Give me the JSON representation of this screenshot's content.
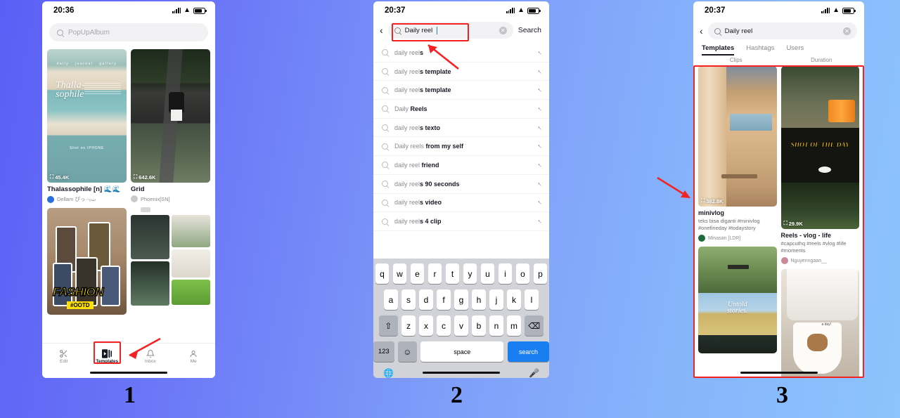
{
  "background": {
    "from": "#5b5ef5",
    "to": "#8cc4fc"
  },
  "accent_red": "#f42222",
  "steps": [
    {
      "number": "1"
    },
    {
      "number": "2"
    },
    {
      "number": "3"
    }
  ],
  "phone1": {
    "status": {
      "time": "20:36"
    },
    "search": {
      "placeholder": "PopUpAlbum",
      "icon": "search-icon"
    },
    "templates": [
      {
        "title": "Thalassophile [n] 🌊🌊",
        "uses": "45.4K",
        "author": "Dellam ぴっ·-ت₆",
        "avatar_color": "#2a6fdb",
        "art": "beach"
      },
      {
        "title": "Grid",
        "uses": "642.6K",
        "author": "Phoenix[SN]",
        "avatar_color": "#c9c9cd",
        "art": "road"
      },
      {
        "title": "",
        "uses": "",
        "author": "",
        "avatar_color": "#cccccc",
        "art": "fashion"
      },
      {
        "title": "",
        "uses": "",
        "author": "",
        "avatar_color": "#cccccc",
        "art": "minigrid"
      }
    ],
    "nav": [
      {
        "label": "Edit",
        "icon": "scissors-icon",
        "active": false
      },
      {
        "label": "Templates",
        "icon": "templates-icon",
        "active": true
      },
      {
        "label": "Inbox",
        "icon": "bell-icon",
        "active": false
      },
      {
        "label": "Me",
        "icon": "person-icon",
        "active": false
      }
    ]
  },
  "phone2": {
    "status": {
      "time": "20:37"
    },
    "back_icon": "chevron-left-icon",
    "search": {
      "value": "Daily reel",
      "clear_icon": "clear-circle-icon",
      "button": "Search"
    },
    "suggestions": [
      {
        "match": "daily reel",
        "rest": "s"
      },
      {
        "match": "daily reel",
        "rest": "s template"
      },
      {
        "match": "daily reel",
        "rest": "s template"
      },
      {
        "match": "Daily ",
        "rest": "Reels"
      },
      {
        "match": "daily reel",
        "rest": "s texto"
      },
      {
        "match": "Daily reels ",
        "rest": "from my self"
      },
      {
        "match": "daily reel ",
        "rest": "friend"
      },
      {
        "match": "daily reel",
        "rest": "s 90 seconds"
      },
      {
        "match": "daily reel",
        "rest": "s video"
      },
      {
        "match": "daily reel",
        "rest": "s 4 clip"
      }
    ],
    "keyboard": {
      "row1": [
        "q",
        "w",
        "e",
        "r",
        "t",
        "y",
        "u",
        "i",
        "o",
        "p"
      ],
      "row2": [
        "a",
        "s",
        "d",
        "f",
        "g",
        "h",
        "j",
        "k",
        "l"
      ],
      "row3": [
        "z",
        "x",
        "c",
        "v",
        "b",
        "n",
        "m"
      ],
      "shift": "⇧",
      "backspace": "⌫",
      "numbers": "123",
      "emoji": "☺",
      "space": "space",
      "search": "search",
      "globe": "🌐",
      "mic": "🎤"
    }
  },
  "phone3": {
    "status": {
      "time": "20:37"
    },
    "back_icon": "chevron-left-icon",
    "search": {
      "value": "Daily reel",
      "clear_icon": "clear-circle-icon"
    },
    "tabs": [
      {
        "label": "Templates",
        "active": true
      },
      {
        "label": "Hashtags",
        "active": false
      },
      {
        "label": "Users",
        "active": false
      }
    ],
    "filters": [
      "Clips",
      "Duration"
    ],
    "results": [
      {
        "title": "minivlog",
        "desc": "teks bisa diganti #minivlog #onefineday #todaystory",
        "author": "Minasan [LDR]",
        "avatar_color": "#1d6b3a",
        "uses": "382.8K",
        "art": "window"
      },
      {
        "title": "Reels - vlog - life",
        "desc": "#capcuthq #reels #vlog #life #moments",
        "author": "Nguyenngaan__",
        "avatar_color": "#c98b9c",
        "uses": "29.9K",
        "art": "vlog",
        "overlay_text": "SHOT OF THE DAY"
      },
      {
        "title": "",
        "desc": "",
        "author": "",
        "avatar_color": "#cccccc",
        "uses": "",
        "art": "untold",
        "overlay_text": "Untold stories."
      },
      {
        "title": "",
        "desc": "",
        "author": "",
        "avatar_color": "#cccccc",
        "uses": "",
        "art": "coffee",
        "overlay_text": "a day!"
      }
    ]
  }
}
